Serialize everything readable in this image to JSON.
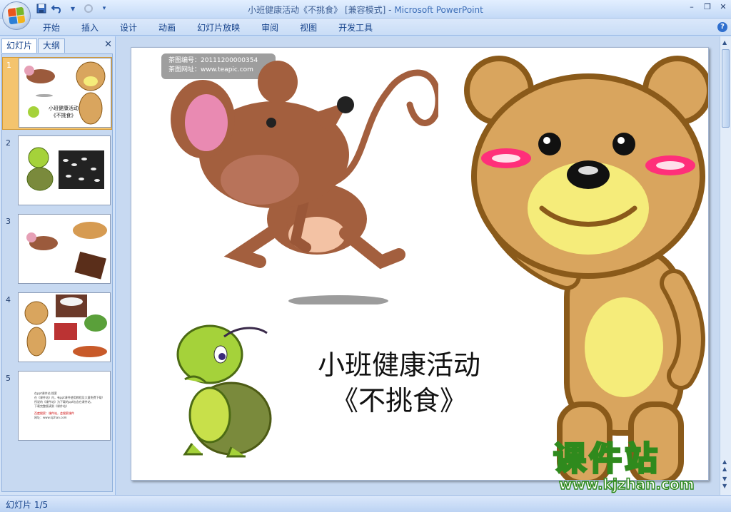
{
  "window": {
    "title_doc": "小班健康活动《不挑食》 [兼容模式] - ",
    "title_app": "Microsoft PowerPoint"
  },
  "ribbon": {
    "tabs": [
      "开始",
      "插入",
      "设计",
      "动画",
      "幻灯片放映",
      "审阅",
      "视图",
      "开发工具"
    ]
  },
  "panel": {
    "tab_slides": "幻灯片",
    "tab_outline": "大纲",
    "slide_numbers": [
      "1",
      "2",
      "3",
      "4",
      "5"
    ],
    "thumb1_text": [
      "小班健康活动",
      "《不挑食》"
    ],
    "thumb5_lines": [
      "在ppt课件站 搜索",
      "在《课件站》内，有ppt课件使用教程及大量免费下载！",
      "所说的《课件站》为下载的ppt包含在课件站，",
      "下载完整版请到《课件站》",
      "百度搜索：课件站，会搜索课件",
      "网址：www.kjzhan.com"
    ]
  },
  "slide": {
    "title_line1": "小班健康活动",
    "title_line2": "《不挑食》",
    "watermark_line1": "茶图编号：20111200000354",
    "watermark_line2": "茶图网址：www.teapic.com"
  },
  "brand": {
    "name": "课件站",
    "url": "www.kjzhan.com"
  },
  "status": {
    "slide_indicator": "幻灯片 1/5"
  }
}
